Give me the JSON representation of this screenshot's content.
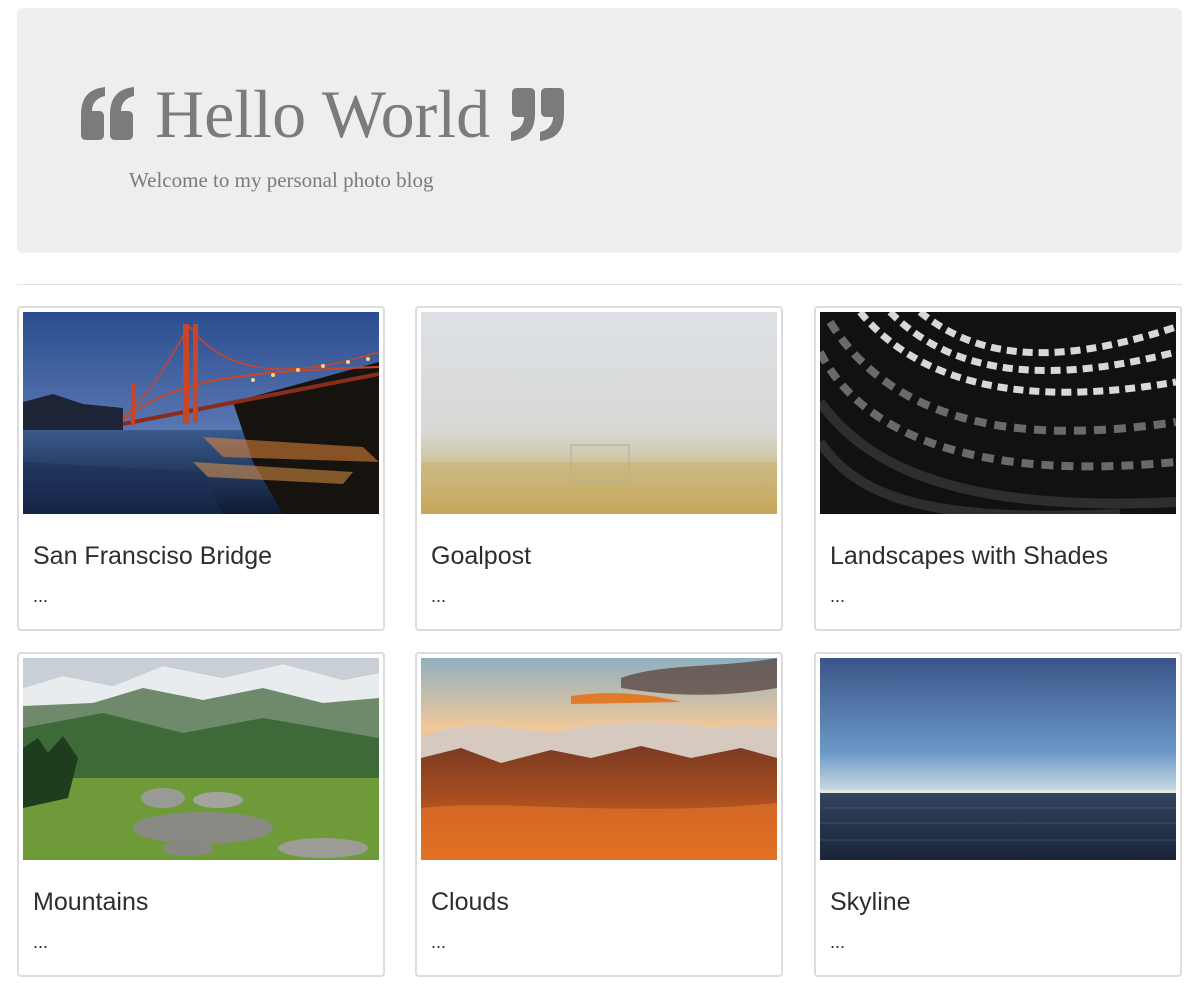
{
  "header": {
    "title": "Hello World",
    "subtitle": "Welcome to my personal photo blog",
    "left_icon": "quote-left-icon",
    "right_icon": "quote-right-icon"
  },
  "posts": [
    {
      "title": "San Fransciso Bridge",
      "excerpt": "...",
      "image": "golden-gate-bridge-photo"
    },
    {
      "title": "Goalpost",
      "excerpt": "...",
      "image": "goalpost-fog-photo"
    },
    {
      "title": "Landscapes with Shades",
      "excerpt": "...",
      "image": "abstract-architecture-photo"
    },
    {
      "title": "Mountains",
      "excerpt": "...",
      "image": "mountains-photo"
    },
    {
      "title": "Clouds",
      "excerpt": "...",
      "image": "clouds-sunset-photo"
    },
    {
      "title": "Skyline",
      "excerpt": "...",
      "image": "ocean-horizon-photo"
    }
  ],
  "colors": {
    "jumbotron_bg": "#eeeeee",
    "heading_text": "#7b7b7b",
    "card_border": "#dcdcdc",
    "body_text": "#2d2d2d"
  }
}
